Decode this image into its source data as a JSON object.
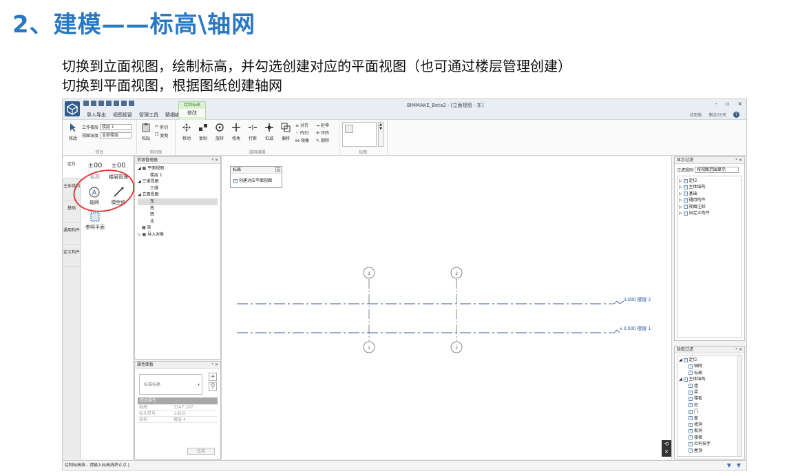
{
  "slide": {
    "title": "2、建模——标高\\轴网",
    "line1": "切换到立面视图，绘制标高，并勾选创建对应的平面视图（也可通过楼层管理创建）",
    "line2": "切换到平面视图，根据图纸创建轴网"
  },
  "app": {
    "window_title": "BIMMAKE_Beta2 - [立面视图 - 东]",
    "menu": [
      "导入导出",
      "视图视窗",
      "管理工具",
      "精细编辑"
    ],
    "context_tab_top": "绘制标高",
    "context_tab_bottom": "修改",
    "trial": "试用版",
    "remaining": "剩余55天",
    "win_controls": [
      "-",
      "▫",
      "×"
    ],
    "ribbon": {
      "modify_label": "修改",
      "work_level_label": "工作楼层",
      "work_level_value": "楼层 1",
      "view_depth_label": "视图深度",
      "view_depth_value": "全部楼层",
      "group_modify": "修改",
      "paste": "粘贴",
      "cut": "剪切",
      "copy_small": "复制",
      "group_clipboard": "剪切板",
      "move": "移动",
      "copy": "复制",
      "rotate": "旋转",
      "trim": "修角",
      "break": "打断",
      "deduct": "扣减",
      "offset": "偏移",
      "align": "对齐",
      "extend": "延伸",
      "array": "阵列",
      "ring": "环阵",
      "mirror": "镜像",
      "delete": "删除",
      "group_general": "通用编辑",
      "group_draw": "绘制"
    },
    "left_tabs": [
      "定位",
      "主体结构",
      "基础",
      "通用构件",
      "定义构件"
    ],
    "tools": {
      "level": "标高",
      "floor_mgmt": "楼层管理",
      "grid": "轴网",
      "model_line": "模型线",
      "ref_plane": "参照平面",
      "level_icon": "±00",
      "floor_icon": "±00"
    },
    "resource": {
      "title": "资源管理器",
      "items": [
        "平面视图",
        "楼层 1",
        "三维视图",
        "三维",
        "立面视图",
        "东",
        "南",
        "西",
        "北",
        "族",
        "导入对象"
      ]
    },
    "popup": {
      "title": "标高",
      "checkbox": "创建对应平面视图"
    },
    "canvas": {
      "grid1": "1",
      "grid2": "2",
      "level2": "3.000 楼层 2",
      "level1": "± 0.000 楼层 1"
    },
    "props": {
      "title": "属性面板",
      "type": "标准标高",
      "section": "基本属性",
      "rows": [
        {
          "k": "标高",
          "v": "3347.107"
        },
        {
          "k": "标头符号",
          "v": "上标头"
        },
        {
          "k": "名称",
          "v": "楼层 4"
        }
      ],
      "apply": "应用"
    },
    "display_filter": {
      "title": "显示过滤",
      "rule_label": "过滤规则",
      "rule_value": "按视图范围显示",
      "items": [
        "定位",
        "主体结构",
        "基础",
        "通用构件",
        "视图注释",
        "自定义构件"
      ]
    },
    "pick_filter": {
      "title": "拾取过滤",
      "items": [
        "定位",
        "轴网",
        "标高",
        "主体结构",
        "墙",
        "梁",
        "楼板",
        "柱",
        "门",
        "窗",
        "墙洞",
        "板洞",
        "楼梯",
        "栏杆扶手",
        "屋顶"
      ]
    },
    "status": "绘制标高线 - 请输入标高线终止点 |"
  }
}
